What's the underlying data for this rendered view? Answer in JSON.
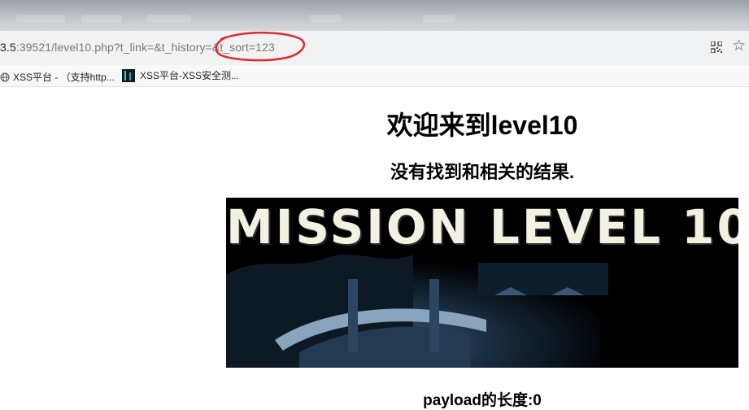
{
  "browser": {
    "address_bar": {
      "url_host": "3.5",
      "url_rest": ":39521/level10.php?t_link=&t_history=&t_sort=123"
    },
    "bookmarks": [
      {
        "label": "XSS平台 - （支持http..."
      },
      {
        "label": "XSS平台-XSS安全测..."
      }
    ]
  },
  "page": {
    "heading": "欢迎来到level10",
    "result_text": "没有找到和相关的结果.",
    "banner_text": "MISSION LEVEL 10",
    "payload_text": "payload的长度:0"
  },
  "colors": {
    "annotation_circle": "#e0282a",
    "address_bar_bg": "#f1f2f4",
    "bookmark_bar_bg": "#f8f8f8"
  }
}
